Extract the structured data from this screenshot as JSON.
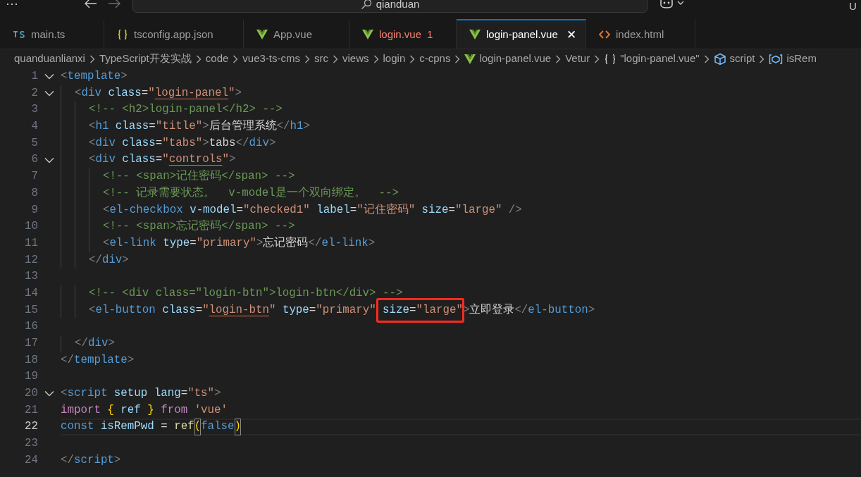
{
  "title_bar": {
    "menu": "⋯",
    "search": {
      "value": "qianduan"
    },
    "account": "U"
  },
  "tabs": [
    {
      "label": "main.ts",
      "kind": "ts",
      "selected": false,
      "has_errors": false
    },
    {
      "label": "tsconfig.app.json",
      "kind": "json",
      "selected": false,
      "has_errors": false
    },
    {
      "label": "App.vue",
      "kind": "vue",
      "selected": false,
      "has_errors": false
    },
    {
      "label": "login.vue",
      "kind": "vue",
      "selected": false,
      "has_errors": true,
      "problem_count": "1"
    },
    {
      "label": "login-panel.vue",
      "kind": "vue",
      "selected": true,
      "has_errors": false,
      "close": "✕"
    },
    {
      "label": "index.html",
      "kind": "html",
      "selected": false,
      "has_errors": false
    }
  ],
  "breadcrumb": [
    {
      "label": "quanduanlianxi",
      "kind": "folder"
    },
    {
      "label": "TypeScript开发实战",
      "kind": "folder"
    },
    {
      "label": "code",
      "kind": "folder"
    },
    {
      "label": "vue3-ts-cms",
      "kind": "folder"
    },
    {
      "label": "src",
      "kind": "folder"
    },
    {
      "label": "views",
      "kind": "folder"
    },
    {
      "label": "login",
      "kind": "folder"
    },
    {
      "label": "c-cpns",
      "kind": "folder"
    },
    {
      "label": "login-panel.vue",
      "kind": "vue"
    },
    {
      "label": "Vetur",
      "kind": "folder"
    },
    {
      "label": "\"login-panel.vue\"",
      "kind": "braces"
    },
    {
      "label": "script",
      "kind": "cube"
    },
    {
      "label": "isRem",
      "kind": "variable"
    }
  ],
  "editor": {
    "lines": [
      {
        "number": "1",
        "foldable": true,
        "current": false,
        "tokens": [
          {
            "text": "<",
            "kind": "punct"
          },
          {
            "text": "template",
            "kind": "tag"
          },
          {
            "text": ">",
            "kind": "punct"
          }
        ]
      },
      {
        "number": "2",
        "foldable": true,
        "current": false,
        "tokens": [
          {
            "text": "  <",
            "kind": "punct"
          },
          {
            "text": "div",
            "kind": "tag"
          },
          {
            "text": " class",
            "kind": "attr"
          },
          {
            "text": "=",
            "kind": "plain"
          },
          {
            "text": "\"",
            "kind": "str"
          },
          {
            "text": "login-panel",
            "kind": "str",
            "warn": true
          },
          {
            "text": "\"",
            "kind": "str"
          },
          {
            "text": ">",
            "kind": "punct"
          }
        ]
      },
      {
        "number": "3",
        "foldable": false,
        "current": false,
        "tokens": [
          {
            "text": "    <!-- <h2>login-panel</h2> -->",
            "kind": "comment"
          }
        ]
      },
      {
        "number": "4",
        "foldable": false,
        "current": false,
        "tokens": [
          {
            "text": "    <",
            "kind": "punct"
          },
          {
            "text": "h1",
            "kind": "tag"
          },
          {
            "text": " class",
            "kind": "attr"
          },
          {
            "text": "=",
            "kind": "plain"
          },
          {
            "text": "\"title\"",
            "kind": "str"
          },
          {
            "text": ">",
            "kind": "punct"
          },
          {
            "text": "后台管理系统",
            "kind": "plain"
          },
          {
            "text": "</",
            "kind": "punct"
          },
          {
            "text": "h1",
            "kind": "tag"
          },
          {
            "text": ">",
            "kind": "punct"
          }
        ]
      },
      {
        "number": "5",
        "foldable": false,
        "current": false,
        "tokens": [
          {
            "text": "    <",
            "kind": "punct"
          },
          {
            "text": "div",
            "kind": "tag"
          },
          {
            "text": " class",
            "kind": "attr"
          },
          {
            "text": "=",
            "kind": "plain"
          },
          {
            "text": "\"tabs\"",
            "kind": "str"
          },
          {
            "text": ">",
            "kind": "punct"
          },
          {
            "text": "tabs",
            "kind": "plain"
          },
          {
            "text": "</",
            "kind": "punct"
          },
          {
            "text": "div",
            "kind": "tag"
          },
          {
            "text": ">",
            "kind": "punct"
          }
        ]
      },
      {
        "number": "6",
        "foldable": true,
        "current": false,
        "tokens": [
          {
            "text": "    <",
            "kind": "punct"
          },
          {
            "text": "div",
            "kind": "tag"
          },
          {
            "text": " class",
            "kind": "attr"
          },
          {
            "text": "=",
            "kind": "plain"
          },
          {
            "text": "\"",
            "kind": "str"
          },
          {
            "text": "controls",
            "kind": "str",
            "warn": true
          },
          {
            "text": "\"",
            "kind": "str"
          },
          {
            "text": ">",
            "kind": "punct"
          }
        ]
      },
      {
        "number": "7",
        "foldable": false,
        "current": false,
        "tokens": [
          {
            "text": "      <!-- <span>记住密码</span> -->",
            "kind": "comment"
          }
        ]
      },
      {
        "number": "8",
        "foldable": false,
        "current": false,
        "tokens": [
          {
            "text": "      <!-- 记录需要状态。  v-model是一个双向绑定。  -->",
            "kind": "comment"
          }
        ]
      },
      {
        "number": "9",
        "foldable": false,
        "current": false,
        "tokens": [
          {
            "text": "      <",
            "kind": "punct"
          },
          {
            "text": "el-checkbox",
            "kind": "tag"
          },
          {
            "text": " v-model",
            "kind": "attr"
          },
          {
            "text": "=",
            "kind": "plain"
          },
          {
            "text": "\"checked1\"",
            "kind": "str"
          },
          {
            "text": " label",
            "kind": "attr"
          },
          {
            "text": "=",
            "kind": "plain"
          },
          {
            "text": "\"记住密码\"",
            "kind": "str"
          },
          {
            "text": " size",
            "kind": "attr"
          },
          {
            "text": "=",
            "kind": "plain"
          },
          {
            "text": "\"large\"",
            "kind": "str"
          },
          {
            "text": " />",
            "kind": "punct"
          }
        ]
      },
      {
        "number": "10",
        "foldable": false,
        "current": false,
        "tokens": [
          {
            "text": "      <!-- <span>忘记密码</span> -->",
            "kind": "comment"
          }
        ]
      },
      {
        "number": "11",
        "foldable": false,
        "current": false,
        "tokens": [
          {
            "text": "      <",
            "kind": "punct"
          },
          {
            "text": "el-link",
            "kind": "tag"
          },
          {
            "text": " type",
            "kind": "attr"
          },
          {
            "text": "=",
            "kind": "plain"
          },
          {
            "text": "\"primary\"",
            "kind": "str"
          },
          {
            "text": ">",
            "kind": "punct"
          },
          {
            "text": "忘记密码",
            "kind": "plain"
          },
          {
            "text": "</",
            "kind": "punct"
          },
          {
            "text": "el-link",
            "kind": "tag"
          },
          {
            "text": ">",
            "kind": "punct"
          }
        ]
      },
      {
        "number": "12",
        "foldable": false,
        "current": false,
        "tokens": [
          {
            "text": "    </",
            "kind": "punct"
          },
          {
            "text": "div",
            "kind": "tag"
          },
          {
            "text": ">",
            "kind": "punct"
          }
        ]
      },
      {
        "number": "13",
        "foldable": false,
        "current": false
      },
      {
        "number": "14",
        "foldable": false,
        "current": false,
        "tokens": [
          {
            "text": "    <!-- <div class=\"login-btn\">login-btn</div> -->",
            "kind": "comment"
          }
        ]
      },
      {
        "number": "15",
        "foldable": false,
        "current": false,
        "tokens": [
          {
            "text": "    <",
            "kind": "punct"
          },
          {
            "text": "el-button",
            "kind": "tag"
          },
          {
            "text": " class",
            "kind": "attr"
          },
          {
            "text": "=",
            "kind": "plain"
          },
          {
            "text": "\"",
            "kind": "str"
          },
          {
            "text": "login-btn",
            "kind": "str",
            "warn": true
          },
          {
            "text": "\"",
            "kind": "str"
          },
          {
            "text": " type",
            "kind": "attr"
          },
          {
            "text": "=",
            "kind": "plain"
          },
          {
            "text": "\"primary\"",
            "kind": "str"
          },
          {
            "text": " size",
            "kind": "attr",
            "boxed": true
          },
          {
            "text": "=",
            "kind": "plain",
            "boxed": true
          },
          {
            "text": "\"large\"",
            "kind": "str",
            "boxed": true
          },
          {
            "text": ">",
            "kind": "punct"
          },
          {
            "text": "立即登录",
            "kind": "plain"
          },
          {
            "text": "</",
            "kind": "punct"
          },
          {
            "text": "el-button",
            "kind": "tag"
          },
          {
            "text": ">",
            "kind": "punct"
          }
        ]
      },
      {
        "number": "16",
        "foldable": false,
        "current": false
      },
      {
        "number": "17",
        "foldable": false,
        "current": false,
        "tokens": [
          {
            "text": "  </",
            "kind": "punct"
          },
          {
            "text": "div",
            "kind": "tag"
          },
          {
            "text": ">",
            "kind": "punct"
          }
        ]
      },
      {
        "number": "18",
        "foldable": false,
        "current": false,
        "tokens": [
          {
            "text": "</",
            "kind": "punct"
          },
          {
            "text": "template",
            "kind": "tag"
          },
          {
            "text": ">",
            "kind": "punct"
          }
        ]
      },
      {
        "number": "19",
        "foldable": false,
        "current": false
      },
      {
        "number": "20",
        "foldable": true,
        "current": false,
        "tokens": [
          {
            "text": "<",
            "kind": "punct"
          },
          {
            "text": "script",
            "kind": "tag"
          },
          {
            "text": " setup",
            "kind": "attr"
          },
          {
            "text": " lang",
            "kind": "attr"
          },
          {
            "text": "=",
            "kind": "plain"
          },
          {
            "text": "\"ts\"",
            "kind": "str"
          },
          {
            "text": ">",
            "kind": "punct"
          }
        ]
      },
      {
        "number": "21",
        "foldable": false,
        "current": false,
        "tokens": [
          {
            "text": "import",
            "kind": "keyword"
          },
          {
            "text": " {",
            "kind": "bracket"
          },
          {
            "text": " ref",
            "kind": "var"
          },
          {
            "text": " }",
            "kind": "bracket"
          },
          {
            "text": " from",
            "kind": "keyword"
          },
          {
            "text": " 'vue'",
            "kind": "str"
          }
        ]
      },
      {
        "number": "22",
        "foldable": false,
        "current": true,
        "tokens": [
          {
            "text": "const",
            "kind": "storage"
          },
          {
            "text": " isRemPwd",
            "kind": "var"
          },
          {
            "text": " = ",
            "kind": "plain"
          },
          {
            "text": "ref",
            "kind": "func"
          },
          {
            "text": "(",
            "kind": "bracket",
            "matched": true
          },
          {
            "text": "false",
            "kind": "storage"
          },
          {
            "text": ")",
            "kind": "bracket",
            "matched": true
          }
        ]
      },
      {
        "number": "23",
        "foldable": false,
        "current": false
      },
      {
        "number": "24",
        "foldable": false,
        "current": false,
        "tokens": [
          {
            "text": "</",
            "kind": "punct"
          },
          {
            "text": "script",
            "kind": "tag"
          },
          {
            "text": ">",
            "kind": "punct"
          }
        ]
      }
    ]
  }
}
